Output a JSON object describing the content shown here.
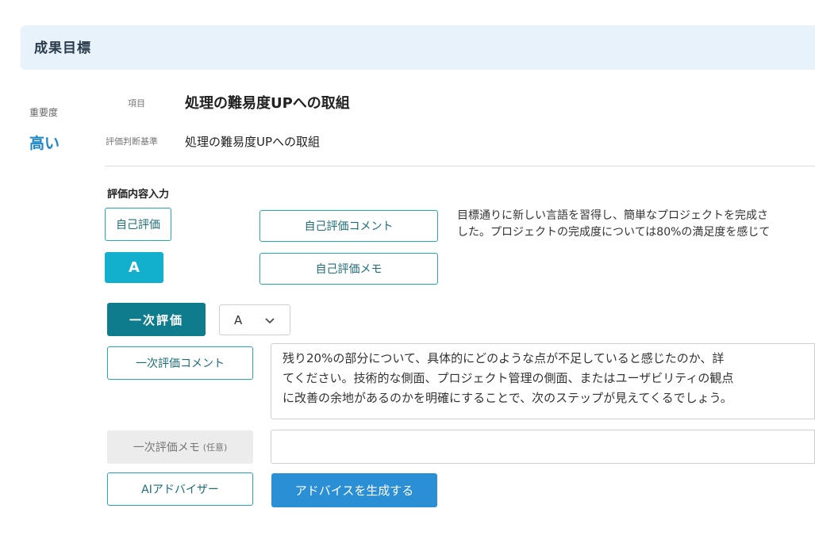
{
  "section": {
    "title": "成果目標"
  },
  "importance": {
    "label": "重要度",
    "value": "高い"
  },
  "item": {
    "label": "項目",
    "value": "処理の難易度UPへの取組"
  },
  "criteria": {
    "label": "評価判断基準",
    "value": "処理の難易度UPへの取組"
  },
  "evaluation": {
    "section_title": "評価内容入力",
    "self_eval_label": "自己評価",
    "self_grade": "A",
    "self_comment_label": "自己評価コメント",
    "self_memo_label": "自己評価メモ",
    "self_comment_lines": [
      "目標通りに新しい言語を習得し、簡単なプロジェクトを完成さ",
      "した。プロジェクトの完成度については80%の満足度を感じて"
    ]
  },
  "first_eval": {
    "button_label": "一次評価",
    "selected_grade": "A",
    "comment_label": "一次評価コメント",
    "comment_lines": [
      "残り20%の部分について、具体的にどのような点が不足していると感じたのか、詳",
      "てください。技術的な側面、プロジェクト管理の側面、またはユーザビリティの観点",
      "に改善の余地があるのかを明確にすることで、次のステップが見えてくるでしょう。"
    ],
    "memo_label": "一次評価メモ",
    "memo_optional": "(任意)",
    "memo_value": ""
  },
  "ai": {
    "advisor_label": "AIアドバイザー",
    "generate_label": "アドバイスを生成する"
  },
  "colors": {
    "accent_teal": "#0e7c8c",
    "grade_cyan": "#12b0cc",
    "primary_blue": "#2b8fd6",
    "importance_blue": "#1f86c6",
    "header_bg": "#e8f2fb"
  }
}
